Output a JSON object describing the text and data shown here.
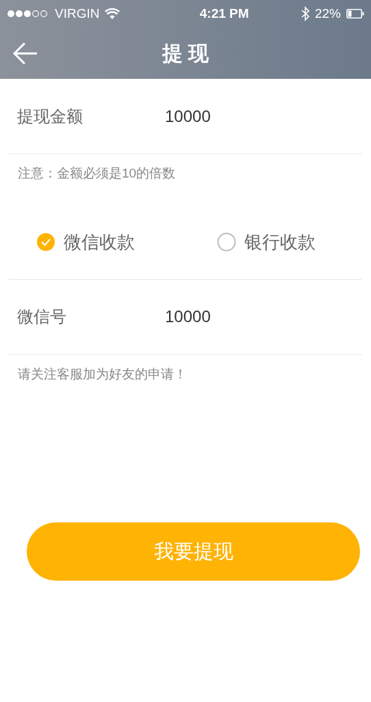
{
  "status_bar": {
    "carrier": "VIRGIN",
    "time": "4:21 PM",
    "battery": "22%"
  },
  "nav": {
    "title": "提 现"
  },
  "amount": {
    "label": "提现金额",
    "value": "10000"
  },
  "amount_note": "注意：金额必须是10的倍数",
  "methods": [
    {
      "label": "微信收款",
      "selected": true
    },
    {
      "label": "银行收款",
      "selected": false
    }
  ],
  "wechat": {
    "label": "微信号",
    "value": "10000"
  },
  "wechat_note": "请关注客服加为好友的申请！",
  "submit": "我要提现"
}
